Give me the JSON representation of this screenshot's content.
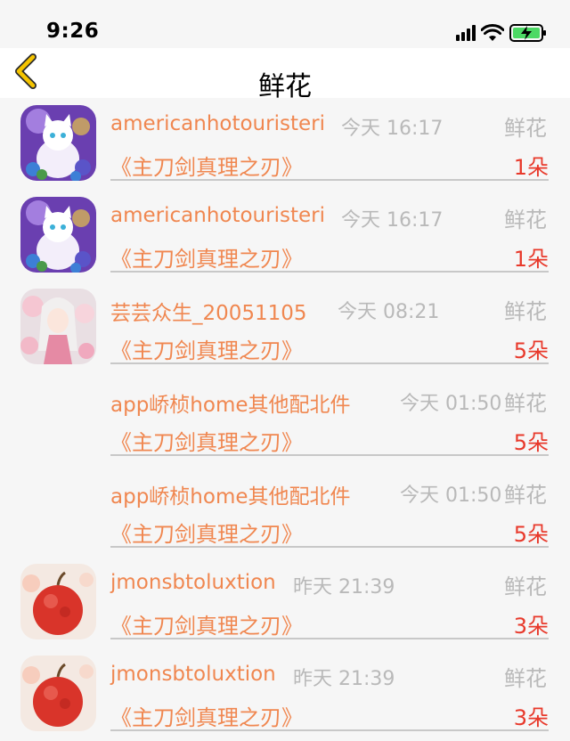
{
  "status": {
    "time": "9:26"
  },
  "nav": {
    "title": "鲜花"
  },
  "rows": [
    {
      "avatar": "cat",
      "name": "americanhotouristeri",
      "time": "今天 16:17",
      "gift": "鲜花",
      "work": "《主刀剑真理之刃》",
      "count": "1朵"
    },
    {
      "avatar": "cat",
      "name": "americanhotouristeri",
      "time": "今天 16:17",
      "gift": "鲜花",
      "work": "《主刀剑真理之刃》",
      "count": "1朵"
    },
    {
      "avatar": "girl",
      "name": "芸芸众生_20051105",
      "time": "今天 08:21",
      "gift": "鲜花",
      "work": "《主刀剑真理之刃》",
      "count": "5朵"
    },
    {
      "avatar": "none",
      "name": "app峤桢home其他配北件",
      "time": "今天 01:50",
      "gift": "鲜花",
      "work": "《主刀剑真理之刃》",
      "count": "5朵"
    },
    {
      "avatar": "none",
      "name": "app峤桢home其他配北件",
      "time": "今天 01:50",
      "gift": "鲜花",
      "work": "《主刀剑真理之刃》",
      "count": "5朵"
    },
    {
      "avatar": "apple",
      "name": "jmonsbtoluxtion",
      "time": "昨天 21:39",
      "gift": "鲜花",
      "work": "《主刀剑真理之刃》",
      "count": "3朵"
    },
    {
      "avatar": "apple",
      "name": "jmonsbtoluxtion",
      "time": "昨天 21:39",
      "gift": "鲜花",
      "work": "《主刀剑真理之刃》",
      "count": "3朵"
    }
  ],
  "colors": {
    "accent": "#f08750",
    "count": "#e8392b",
    "muted": "#b9b9b9",
    "back_arrow": "#f5c400"
  }
}
